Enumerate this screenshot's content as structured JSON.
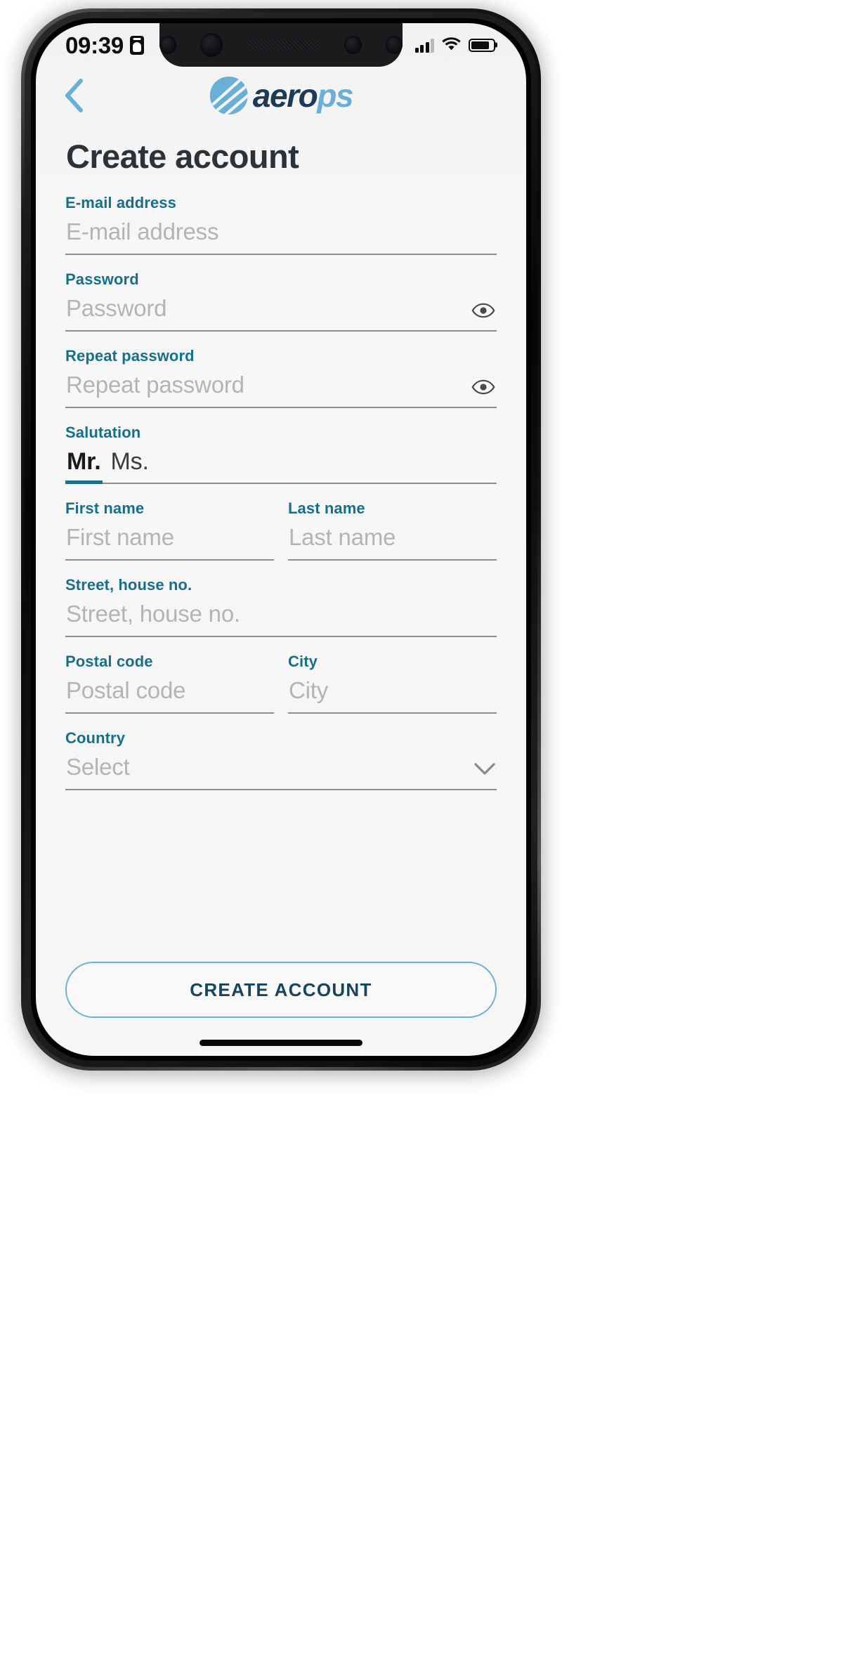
{
  "statusbar": {
    "time": "09:39",
    "id_icon": "id-badge-icon",
    "signal_icon": "cellular-signal-icon",
    "wifi_icon": "wifi-icon",
    "battery_icon": "battery-icon"
  },
  "header": {
    "back_icon": "chevron-left-icon",
    "logo_mark_icon": "aerops-globe-icon",
    "logo_text_dark": "aero",
    "logo_text_blue": "ps"
  },
  "page": {
    "title": "Create account"
  },
  "form": {
    "email": {
      "label": "E-mail address",
      "placeholder": "E-mail address",
      "value": ""
    },
    "password": {
      "label": "Password",
      "placeholder": "Password",
      "value": "",
      "toggle_icon": "eye-icon"
    },
    "repeat_password": {
      "label": "Repeat password",
      "placeholder": "Repeat password",
      "value": "",
      "toggle_icon": "eye-icon"
    },
    "salutation": {
      "label": "Salutation",
      "options": [
        "Mr.",
        "Ms."
      ],
      "selected": "Mr."
    },
    "first_name": {
      "label": "First name",
      "placeholder": "First name",
      "value": ""
    },
    "last_name": {
      "label": "Last name",
      "placeholder": "Last name",
      "value": ""
    },
    "street": {
      "label": "Street, house no.",
      "placeholder": "Street, house no.",
      "value": ""
    },
    "postal_code": {
      "label": "Postal code",
      "placeholder": "Postal code",
      "value": ""
    },
    "city": {
      "label": "City",
      "placeholder": "City",
      "value": ""
    },
    "country": {
      "label": "Country",
      "placeholder": "Select",
      "value": "",
      "chevron_icon": "chevron-down-icon"
    }
  },
  "cta": {
    "label": "CREATE ACCOUNT"
  },
  "colors": {
    "label_teal": "#16708d",
    "accent_blue": "#6aafd6",
    "logo_dark": "#1d3a56",
    "title_dark": "#2b3338",
    "placeholder_gray": "#b4b4b4",
    "underline_gray": "#8d8d8d",
    "cta_text": "#17435c",
    "screen_bg": "#f6f6f6"
  }
}
